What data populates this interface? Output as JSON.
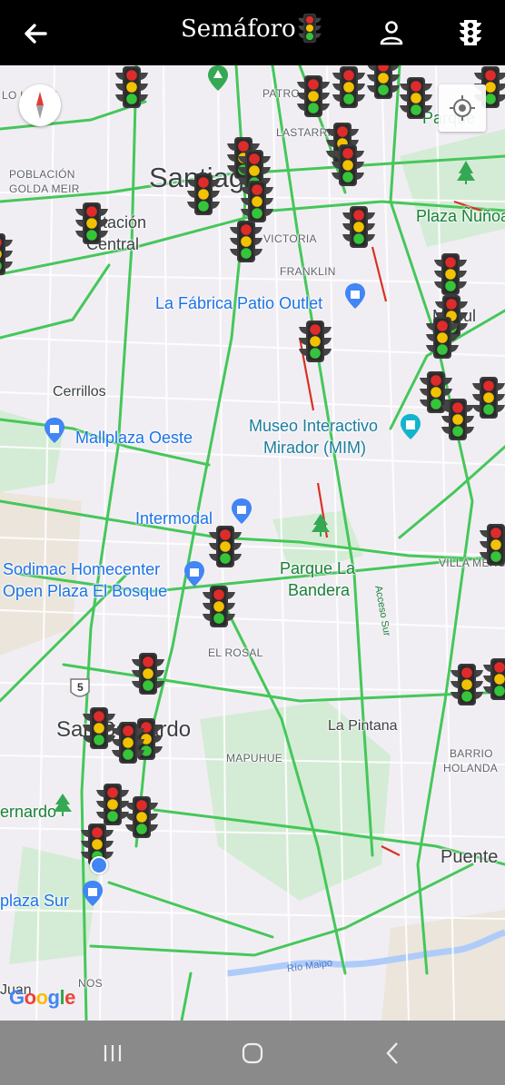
{
  "appbar": {
    "title": "Semáforo",
    "back_icon": "arrow-back-icon",
    "user_icon": "person-icon",
    "signals_icon": "traffic-light-icon"
  },
  "colors": {
    "appbar_bg": "#000000",
    "map_bg": "#f1eef3",
    "traffic_green": "#45c75a",
    "traffic_red": "#d93025",
    "park_green": "#c5e6c9",
    "nav_bar_bg": "#8a8a8a"
  },
  "map": {
    "labels": {
      "lo_lopez": "LO LOPEZ",
      "patro": "PATRO",
      "parque": "Parque",
      "lastarria": "LASTARRIA",
      "poblacion": "POBLACIÓN",
      "golda_meir": "GOLDA MEIR",
      "santiago": "Santiago",
      "estacion": "Estación",
      "central": "Central",
      "victoria": "VICTORIA",
      "plaza_nunoa": "Plaza Ñuñoa",
      "franklin": "FRANKLIN",
      "la_fabrica": "La Fábrica Patio Outlet",
      "macul": "Macul",
      "cerrillos": "Cerrillos",
      "mallplaza_oeste": "Mallplaza Oeste",
      "museo_line1": "Museo Interactivo",
      "museo_line2": "Mirador (MIM)",
      "intermodal": "Intermodal",
      "villa_mercedes": "VILLA MERCEDES",
      "sodimac_line1": "Sodimac Homecenter",
      "sodimac_line2": "Open Plaza El Bosque",
      "parque_bandera_line1": "Parque La",
      "parque_bandera_line2": "Bandera",
      "acceso_sur": "Acceso Sur",
      "el_rosal": "EL ROSAL",
      "route_5": "5",
      "san_bernardo": "San Bernardo",
      "la_pintana": "La Pintana",
      "mapuhue": "MAPUHUE",
      "barrio_line1": "BARRIO",
      "barrio_line2": "HOLANDA",
      "bernardo": "ernardo",
      "puente": "Puente",
      "plaza_sur": "plaza Sur",
      "rio_maipo": "Río Maipo",
      "nos": "NOS",
      "juan": "Juan",
      "google": "Google"
    },
    "controls": {
      "compass_icon": "compass-icon",
      "my_location_icon": "my-location-icon"
    },
    "traffic_light_marker_icon": "traffic-light-icon"
  },
  "system_nav": {
    "recents_icon": "recent-apps-icon",
    "home_icon": "home-circle-icon",
    "back_icon": "back-chevron-icon"
  }
}
